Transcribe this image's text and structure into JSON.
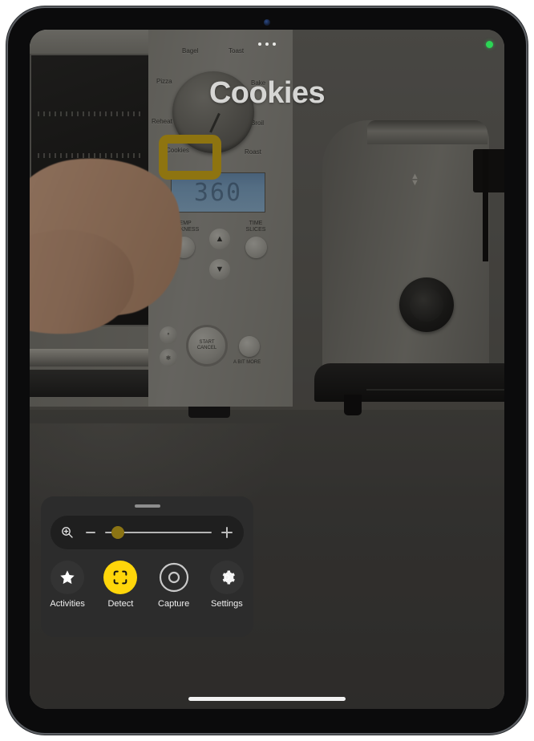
{
  "device": {
    "front_camera_icon": "front-camera-dot",
    "home_indicator": "home-indicator"
  },
  "screen": {
    "status_more_icon": "more-dots-icon",
    "camera_in_use_indicator": "green-camera-dot",
    "detected_title": "Cookies",
    "detection_box": {
      "label": "Cookies",
      "color": "#8e7410"
    }
  },
  "scene": {
    "description": "Camera view of a kitchen counter with a toaster oven and a toaster",
    "oven": {
      "mode_labels_top": [
        "Toast",
        "Bagel",
        "Cookies",
        "Pizza"
      ],
      "mode_labels_bottom": [
        "Bake",
        "Reheat",
        "Roast"
      ],
      "dial_labels": [
        "Bagel",
        "Toast",
        "Pizza",
        "Bake",
        "Reheat",
        "Broil",
        "Cookies",
        "Roast"
      ],
      "display_value": "360",
      "control_labels": {
        "temp": "TEMP",
        "temp_sub": "DARKNESS",
        "time": "TIME",
        "time_sub": "SLICES"
      },
      "start_label": "START",
      "cancel_label": "CANCEL",
      "a_bit_more_label": "A BIT MORE",
      "unit_button": "°F/°C",
      "frozen_button": "frozen-snowflake-icon",
      "arrow_up_icon": "arrow-up-icon",
      "arrow_down_icon": "arrow-down-icon"
    }
  },
  "controls": {
    "grabber_icon": "drag-handle",
    "zoom": {
      "icon": "zoom-magnifier-icon",
      "decrease_icon": "minus-icon",
      "increase_icon": "plus-icon",
      "value_percent": 12,
      "thumb_color": "#8b7414"
    },
    "buttons": [
      {
        "label": "Activities",
        "icon": "star-icon",
        "active": false
      },
      {
        "label": "Detect",
        "icon": "detect-frame-icon",
        "active": true
      },
      {
        "label": "Capture",
        "icon": "shutter-icon",
        "active": false
      },
      {
        "label": "Settings",
        "icon": "gear-icon",
        "active": false
      }
    ]
  },
  "colors": {
    "accent": "#ffd60a",
    "panel_bg": "#2c2c2c",
    "detect_box": "#8e7410",
    "recording_dot": "#2bd655"
  }
}
